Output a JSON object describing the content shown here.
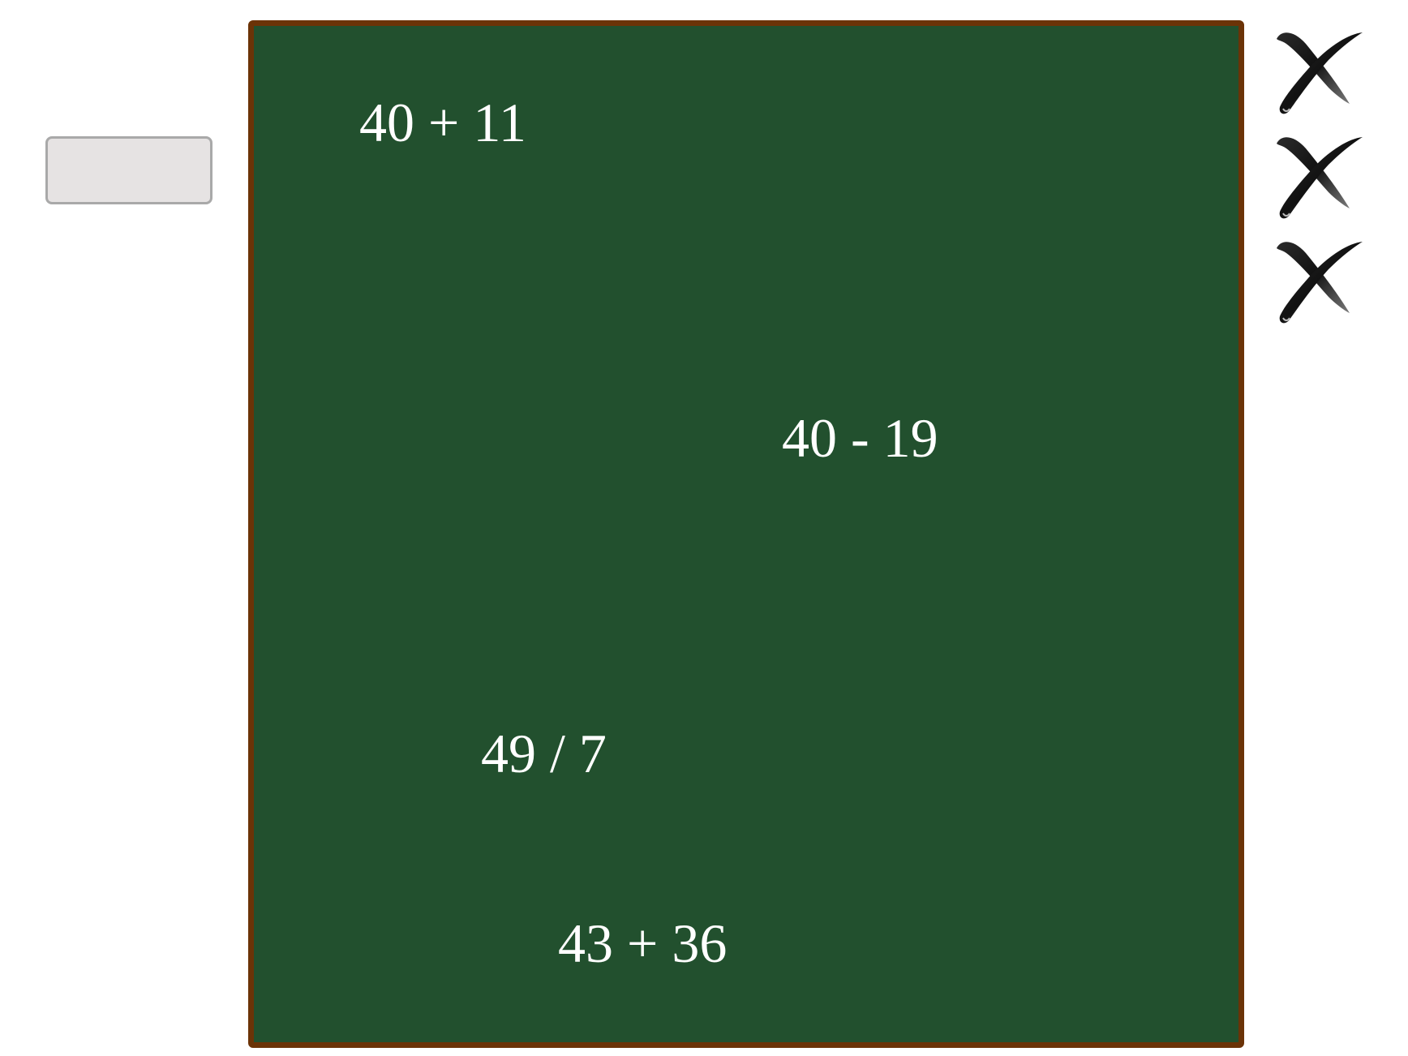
{
  "answer_input": {
    "value": "",
    "placeholder": ""
  },
  "board": {
    "background_color": "#22502e",
    "border_color": "#6b3307",
    "equations": [
      {
        "text": "40 + 11"
      },
      {
        "text": "40 - 19"
      },
      {
        "text": "49 / 7"
      },
      {
        "text": "43 + 36"
      }
    ]
  },
  "lives": {
    "icon": "x-mark-icon",
    "count_shown": 3
  }
}
